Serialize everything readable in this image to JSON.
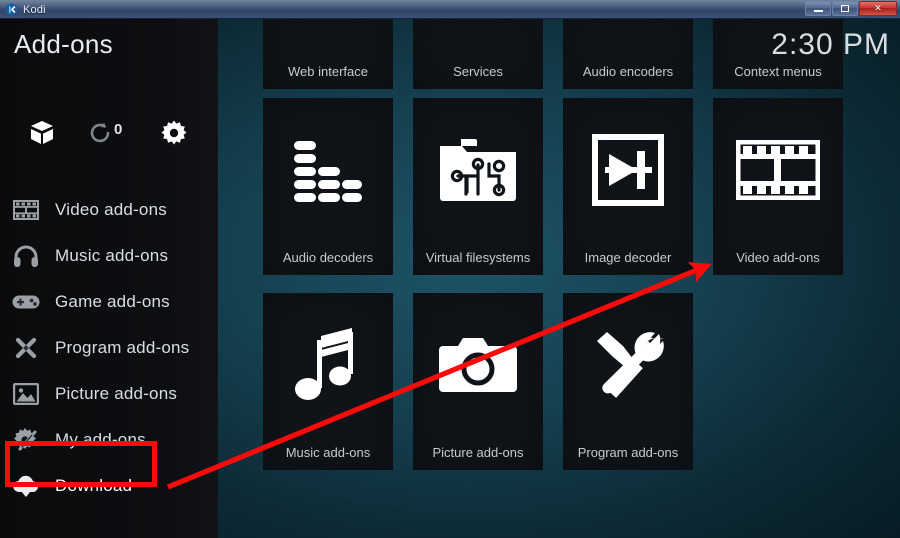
{
  "window": {
    "app_title": "Kodi",
    "center_title": "",
    "minimize_label": "Minimize",
    "maximize_label": "Maximize",
    "close_label": "Close",
    "close_glyph": "✕"
  },
  "sidebar": {
    "page_title": "Add-ons",
    "toolbar": [
      {
        "name": "install-from-zip-icon",
        "label": "Install from repository"
      },
      {
        "name": "refresh-icon",
        "label": "Check for updates"
      },
      {
        "name": "gear-icon",
        "label": "Settings"
      }
    ],
    "update_count": "0",
    "items": [
      {
        "label": "Video add-ons",
        "icon": "film-strip-icon",
        "selected": false
      },
      {
        "label": "Music add-ons",
        "icon": "headphones-icon",
        "selected": false
      },
      {
        "label": "Game add-ons",
        "icon": "gamepad-icon",
        "selected": false
      },
      {
        "label": "Program add-ons",
        "icon": "crossed-tools-icon",
        "selected": false
      },
      {
        "label": "Picture add-ons",
        "icon": "photo-icon",
        "selected": false
      },
      {
        "label": "My add-ons",
        "icon": "gear-screwdriver-icon",
        "selected": false
      },
      {
        "label": "Download",
        "icon": "cloud-download-icon",
        "selected": true
      }
    ]
  },
  "clock": {
    "time": "2:30 PM"
  },
  "content": {
    "tiles_top": [
      {
        "label": "Web interface",
        "icon": "none"
      },
      {
        "label": "Services",
        "icon": "none"
      },
      {
        "label": "Audio encoders",
        "icon": "none"
      },
      {
        "label": "Context menus",
        "icon": "none"
      }
    ],
    "tiles_middle": [
      {
        "label": "Audio decoders",
        "icon": "equalizer-icon"
      },
      {
        "label": "Virtual filesystems",
        "icon": "circuit-folder-icon"
      },
      {
        "label": "Image decoder",
        "icon": "image-decoder-icon"
      },
      {
        "label": "Video add-ons",
        "icon": "film-strip-icon"
      }
    ],
    "tiles_bottom": [
      {
        "label": "Music add-ons",
        "icon": "music-note-icon"
      },
      {
        "label": "Picture add-ons",
        "icon": "camera-icon"
      },
      {
        "label": "Program add-ons",
        "icon": "hammer-wrench-icon"
      }
    ]
  },
  "annotations": {
    "highlight_color": "#f70b0b",
    "arrow_color": "#f70b0b",
    "highlight_target": "Download",
    "arrow_from": "Download",
    "arrow_to": "Video add-ons"
  }
}
